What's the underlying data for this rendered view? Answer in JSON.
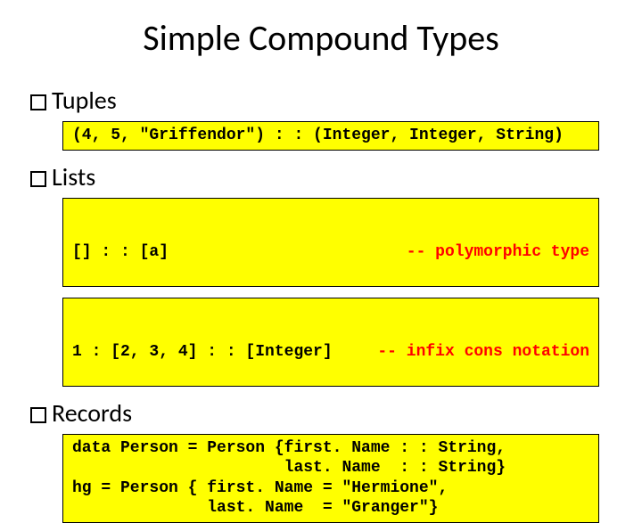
{
  "title": "Simple Compound Types",
  "sections": {
    "tuples": {
      "label": "Tuples",
      "box1": "(4, 5, \"Griffendor\") : : (Integer, Integer, String)"
    },
    "lists": {
      "label": "Lists",
      "box1_left": "[] : : [a]",
      "box1_right": "-- polymorphic type",
      "box2_left": "1 : [2, 3, 4] : : [Integer]",
      "box2_right": "-- infix cons notation"
    },
    "records": {
      "label": "Records",
      "box1": "data Person = Person {first. Name : : String,\n                      last. Name  : : String}\nhg = Person { first. Name = \"Hermione\",\n              last. Name  = \"Granger\"}"
    }
  }
}
